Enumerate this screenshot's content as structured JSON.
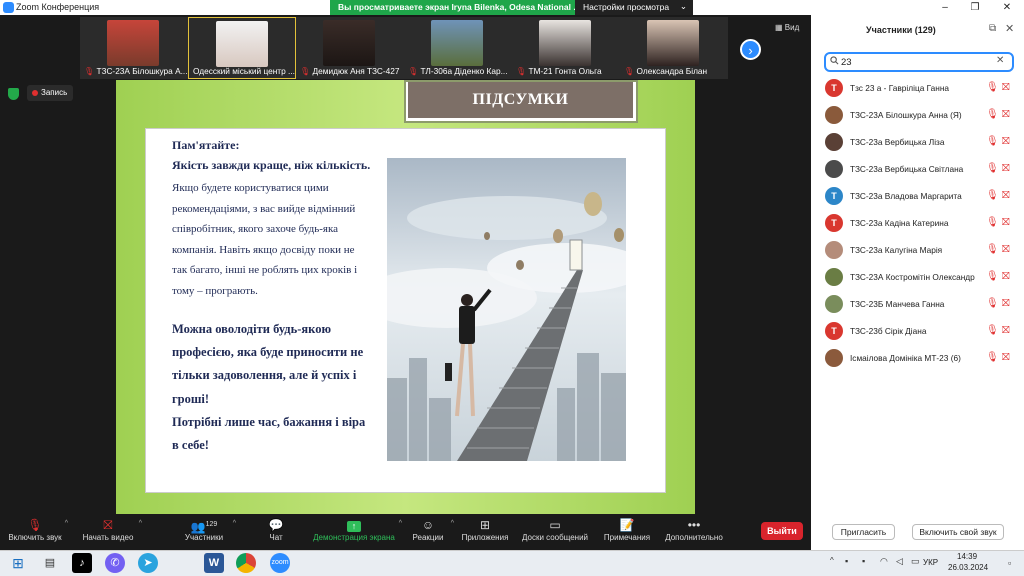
{
  "window": {
    "title": "Zoom Конференция",
    "share_banner": "Вы просматриваете экран Iryna Bilenka, Odesa National ...",
    "view_settings": "Настройки просмотра"
  },
  "video_strip": {
    "view_label": "Вид",
    "thumbnails": [
      {
        "name": "ТЗС-23А Білошкура А..."
      },
      {
        "name": "Одесский міський центр ..."
      },
      {
        "name": "Демидюк Аня ТЗС-427"
      },
      {
        "name": "ТЛ-306а Діденко Кар..."
      },
      {
        "name": "ТМ-21 Гонта Ольга"
      },
      {
        "name": "Олександра Білан"
      }
    ]
  },
  "recording_label": "Запись",
  "slide": {
    "heading": "ПІДСУМКИ",
    "remember": "Пам'ятайте:",
    "quality": "Якість завжди краще, ніж кількість.",
    "para1": "Якщо будете користуватися цими рекомендаціями, з вас вийде відмінний співробітник, якого захоче будь-яка компанія. Навіть якщо досвіду поки не так багато, інші не роблять цих кроків і тому – програють.",
    "para2": "Можна оволодіти будь-якою професією, яка буде приносити не тільки задоволення, але й успіх і гроші!",
    "para3": "Потрібні лише час, бажання і віра в себе!"
  },
  "participants_panel": {
    "title": "Участники (129)",
    "search_value": "23",
    "participants": [
      {
        "name": "Тзс 23 а - Гавріліца Ганна",
        "initial": "T",
        "color": "#d9372f"
      },
      {
        "name": "ТЗС-23А Білошкура Анна (Я)",
        "initial": "",
        "color": "#8a5a3b"
      },
      {
        "name": "ТЗС-23а Вербицька Ліза",
        "initial": "",
        "color": "#5a4036"
      },
      {
        "name": "ТЗС-23а Вербицька Світлана",
        "initial": "",
        "color": "#4b4b4b"
      },
      {
        "name": "ТЗС-23а Владова Маргарита",
        "initial": "T",
        "color": "#2c86c8"
      },
      {
        "name": "ТЗС-23а Кадіна Катерина",
        "initial": "T",
        "color": "#d9372f"
      },
      {
        "name": "ТЗС-23а Калугіна Марія",
        "initial": "",
        "color": "#b48c7a"
      },
      {
        "name": "ТЗС-23А Костромітін Олександр",
        "initial": "",
        "color": "#6a7d44"
      },
      {
        "name": "ТЗС-23Б Манчева Ганна",
        "initial": "",
        "color": "#7a8d5c"
      },
      {
        "name": "ТЗС-23б Сірік Діана",
        "initial": "T",
        "color": "#d9372f"
      },
      {
        "name": "Ісмаілова Домініка МТ-23 (6)",
        "initial": "",
        "color": "#8b5a3c"
      }
    ],
    "invite_label": "Пригласить",
    "unmute_self_label": "Включить свой звук"
  },
  "toolbar": {
    "unmute": "Включить звук",
    "start_video": "Начать видео",
    "participants": "Участники",
    "participants_count": "129",
    "chat": "Чат",
    "share_screen": "Демонстрация экрана",
    "reactions": "Реакции",
    "apps": "Приложения",
    "whiteboards": "Доски сообщений",
    "notes": "Примечания",
    "more": "Дополнительно",
    "leave": "Выйти"
  },
  "taskbar": {
    "lang": "УКР",
    "time": "14:39",
    "date": "26.03.2024"
  }
}
